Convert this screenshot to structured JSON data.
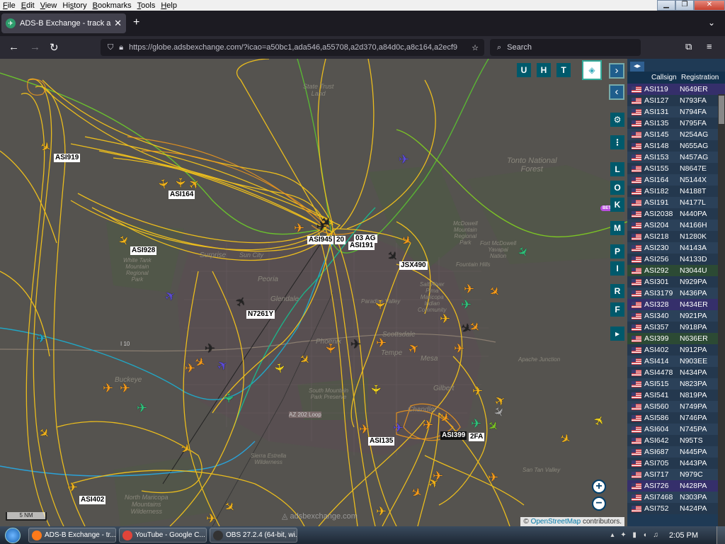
{
  "menu": [
    {
      "label": "File",
      "u": "F"
    },
    {
      "label": "Edit",
      "u": "E"
    },
    {
      "label": "View",
      "u": "V"
    },
    {
      "label": "History",
      "u": "s"
    },
    {
      "label": "Bookmarks",
      "u": "B"
    },
    {
      "label": "Tools",
      "u": "T"
    },
    {
      "label": "Help",
      "u": "H"
    }
  ],
  "tab": {
    "title": "ADS-B Exchange - track aircraft",
    "close": "✕"
  },
  "newtab": "+",
  "nav": {
    "back": "←",
    "forward": "→",
    "reload": "↻",
    "url": "https://globe.adsbexchange.com/?icao=a50bc1,ada546,a55708,a2d370,a84d0c,a8c164,a2ecf9",
    "search_placeholder": "Search"
  },
  "map": {
    "buttons": [
      "U",
      "H",
      "T"
    ],
    "side_buttons": [
      "L",
      "O",
      "K",
      "M",
      "P",
      "I",
      "R",
      "F"
    ],
    "beta": "BETA",
    "zoom_in": "+",
    "zoom_out": "−",
    "scale": "5 NM",
    "watermark": "adsbexchange.com",
    "attribution_pre": "© ",
    "attribution_link": "OpenStreetMap",
    "attribution_post": " contributors.",
    "place_names": [
      {
        "text": "Tonto National\nForest"
      },
      {
        "text": "State Trust\nLand"
      },
      {
        "text": "Sun City"
      },
      {
        "text": "Surprise"
      },
      {
        "text": "White Tank\nMountain\nRegional\nPark"
      },
      {
        "text": "Peoria"
      },
      {
        "text": "Glendale"
      },
      {
        "text": "Phoenix"
      },
      {
        "text": "Scottsdale"
      },
      {
        "text": "Paradise Valley"
      },
      {
        "text": "Tempe"
      },
      {
        "text": "Mesa"
      },
      {
        "text": "Gilbert"
      },
      {
        "text": "Chandler"
      },
      {
        "text": "Buckeye"
      },
      {
        "text": "Fountain Hills"
      },
      {
        "text": "Apache Junction"
      },
      {
        "text": "San Tan Valley"
      },
      {
        "text": "South Mountain\nPark Preserve"
      },
      {
        "text": "Sierra Estrella\nWilderness"
      },
      {
        "text": "North Maricopa\nMountains\nWilderness"
      },
      {
        "text": "AZ 202 Loop"
      },
      {
        "text": "I 10"
      },
      {
        "text": "Salt River\nPima\nMaricopa\nIndian\nCommunity"
      },
      {
        "text": "Fort McDowell\nYavapai\nNation"
      },
      {
        "text": "McDowell\nMountain\nRegional\nPark"
      }
    ],
    "aircraft_labels": [
      {
        "text": "ASI919"
      },
      {
        "text": "ASI164"
      },
      {
        "text": "ASI928"
      },
      {
        "text": "ASI945"
      },
      {
        "text": "20"
      },
      {
        "text": "03 AG"
      },
      {
        "text": "ASI191"
      },
      {
        "text": "JSX490"
      },
      {
        "text": "N7261Y"
      },
      {
        "text": "ASI135"
      },
      {
        "text": "ASI399"
      },
      {
        "text": "2FA"
      },
      {
        "text": "ASI402"
      }
    ]
  },
  "sidebar": {
    "col_callsign": "Callsign",
    "col_registration": "Registration",
    "rows": [
      {
        "cs": "ASI119",
        "reg": "N649ER",
        "style": "hl"
      },
      {
        "cs": "ASI127",
        "reg": "N793FA",
        "style": "even"
      },
      {
        "cs": "ASI131",
        "reg": "N794FA",
        "style": "odd"
      },
      {
        "cs": "ASI135",
        "reg": "N795FA",
        "style": "even"
      },
      {
        "cs": "ASI145",
        "reg": "N254AG",
        "style": "odd"
      },
      {
        "cs": "ASI148",
        "reg": "N655AG",
        "style": "even"
      },
      {
        "cs": "ASI153",
        "reg": "N457AG",
        "style": "odd"
      },
      {
        "cs": "ASI155",
        "reg": "N8647E",
        "style": "even"
      },
      {
        "cs": "ASI164",
        "reg": "N5144X",
        "style": "odd"
      },
      {
        "cs": "ASI182",
        "reg": "N4188T",
        "style": "even"
      },
      {
        "cs": "ASI191",
        "reg": "N4177L",
        "style": "odd"
      },
      {
        "cs": "ASI2038",
        "reg": "N440PA",
        "style": "even"
      },
      {
        "cs": "ASI204",
        "reg": "N4166H",
        "style": "odd"
      },
      {
        "cs": "ASI218",
        "reg": "N1280K",
        "style": "even"
      },
      {
        "cs": "ASI230",
        "reg": "N4143A",
        "style": "odd"
      },
      {
        "cs": "ASI256",
        "reg": "N4133D",
        "style": "even"
      },
      {
        "cs": "ASI292",
        "reg": "N3044U",
        "style": "grn"
      },
      {
        "cs": "ASI301",
        "reg": "N929PA",
        "style": "even"
      },
      {
        "cs": "ASI3179",
        "reg": "N436PA",
        "style": "odd"
      },
      {
        "cs": "ASI328",
        "reg": "N434ER",
        "style": "hl"
      },
      {
        "cs": "ASI340",
        "reg": "N921PA",
        "style": "odd"
      },
      {
        "cs": "ASI357",
        "reg": "N918PA",
        "style": "even"
      },
      {
        "cs": "ASI399",
        "reg": "N636ER",
        "style": "grn"
      },
      {
        "cs": "ASI402",
        "reg": "N912PA",
        "style": "even"
      },
      {
        "cs": "ASI414",
        "reg": "N903EE",
        "style": "odd"
      },
      {
        "cs": "ASI4478",
        "reg": "N434PA",
        "style": "even"
      },
      {
        "cs": "ASI515",
        "reg": "N823PA",
        "style": "odd"
      },
      {
        "cs": "ASI541",
        "reg": "N819PA",
        "style": "even"
      },
      {
        "cs": "ASI560",
        "reg": "N749PA",
        "style": "odd"
      },
      {
        "cs": "ASI586",
        "reg": "N746PA",
        "style": "even"
      },
      {
        "cs": "ASI604",
        "reg": "N745PA",
        "style": "odd"
      },
      {
        "cs": "ASI642",
        "reg": "N95TS",
        "style": "even"
      },
      {
        "cs": "ASI687",
        "reg": "N445PA",
        "style": "odd"
      },
      {
        "cs": "ASI705",
        "reg": "N443PA",
        "style": "even"
      },
      {
        "cs": "ASI717",
        "reg": "N979C",
        "style": "odd"
      },
      {
        "cs": "ASI726",
        "reg": "N428PA",
        "style": "hl"
      },
      {
        "cs": "ASI7468",
        "reg": "N303PA",
        "style": "odd"
      },
      {
        "cs": "ASI752",
        "reg": "N424PA",
        "style": "even"
      }
    ]
  },
  "taskbar": {
    "items": [
      {
        "label": "ADS-B Exchange - tr...",
        "color": "#ff7a1a"
      },
      {
        "label": "YouTube - Google C...",
        "color": "#e0443a"
      },
      {
        "label": "OBS 27.2.4 (64-bit, wi...",
        "color": "#333333"
      }
    ],
    "time": "2:05 PM"
  }
}
